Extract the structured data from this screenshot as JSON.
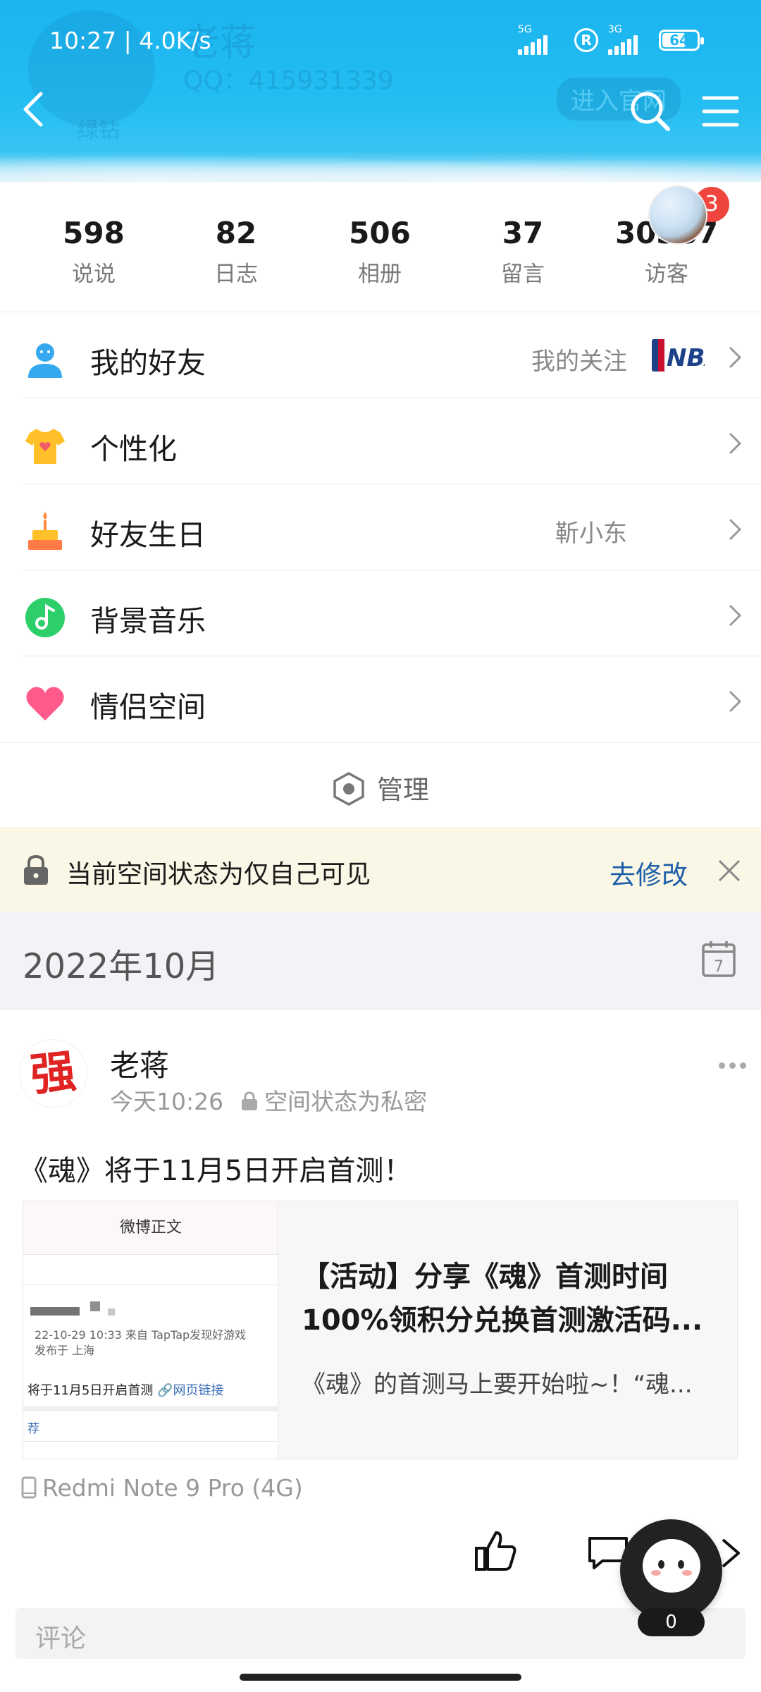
{
  "status_bar": {
    "time_speed": "10:27 | 4.0K/s",
    "net1": "5G",
    "net2": "3G",
    "battery": "64"
  },
  "header_ghost": {
    "name": "老蒋",
    "qq": "QQ：415931339",
    "enter": "进入官网",
    "green": "绿钻"
  },
  "stats": [
    {
      "num": "598",
      "label": "说说"
    },
    {
      "num": "82",
      "label": "日志"
    },
    {
      "num": "506",
      "label": "相册"
    },
    {
      "num": "37",
      "label": "留言"
    },
    {
      "num": "30387",
      "label": "访客"
    }
  ],
  "visitor_badge": "3",
  "menu": [
    {
      "label": "我的好友",
      "right": "我的关注"
    },
    {
      "label": "个性化",
      "right": ""
    },
    {
      "label": "好友生日",
      "right": "靳小东"
    },
    {
      "label": "背景音乐",
      "right": ""
    },
    {
      "label": "情侣空间",
      "right": ""
    }
  ],
  "manage_label": "管理",
  "privacy": {
    "text": "当前空间状态为仅自己可见",
    "action": "去修改"
  },
  "month_title": "2022年10月",
  "post": {
    "author": "老蒋",
    "avatar_char": "强",
    "time": "今天10:26",
    "privacy": "空间状态为私密",
    "text": "《魂》将于11月5日开启首测！",
    "card": {
      "thumb_header": "微博正文",
      "thumb_date": "22-10-29 10:33  来自 TapTap发现好游戏",
      "thumb_loc": "发布于 上海",
      "thumb_line": "将于11月5日开启首测",
      "thumb_link": "🔗网页链接",
      "thumb_rec": "荐",
      "title_line1": "【活动】分享《魂》首测时间",
      "title_line2": "100%领积分兑换首测激活码...",
      "desc": "《魂》的首测马上要开始啦~！“魂..."
    },
    "device": "Redmi Note 9 Pro (4G)",
    "comment_placeholder": "评论"
  },
  "float_badge": "0",
  "colors": {
    "header": "#1bb4f0",
    "accent_link": "#1c5fa8",
    "badge": "#f0453e",
    "privacy_bg": "#fbf7e6"
  }
}
